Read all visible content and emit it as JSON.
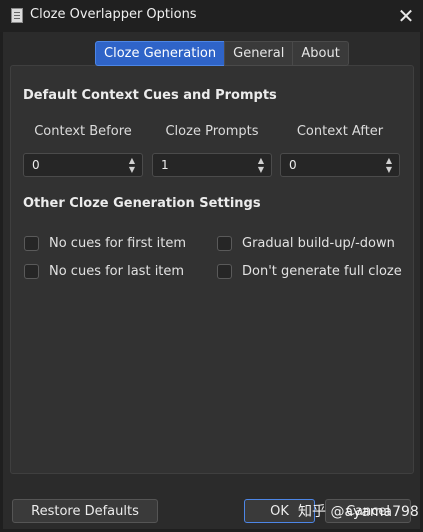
{
  "window": {
    "title": "Cloze Overlapper Options",
    "close_glyph": "✕"
  },
  "tabs": [
    {
      "label": "Cloze Generation",
      "active": true
    },
    {
      "label": "General",
      "active": false
    },
    {
      "label": "About",
      "active": false
    }
  ],
  "context_section": {
    "title": "Default Context Cues and Prompts",
    "fields": [
      {
        "label": "Context Before",
        "value": "0"
      },
      {
        "label": "Cloze Prompts",
        "value": "1"
      },
      {
        "label": "Context After",
        "value": "0"
      }
    ]
  },
  "other_section": {
    "title": "Other Cloze Generation Settings",
    "checkboxes": [
      {
        "label": "No cues for first item",
        "checked": false
      },
      {
        "label": "Gradual build-up/-down",
        "checked": false
      },
      {
        "label": "No cues for last item",
        "checked": false
      },
      {
        "label": "Don't generate full cloze",
        "checked": false
      }
    ]
  },
  "footer": {
    "restore_label": "Restore Defaults",
    "ok_label": "OK",
    "cancel_label": "Cancel"
  },
  "watermark": {
    "text": "知乎 @ayama798"
  },
  "colors": {
    "accent": "#2f64c8",
    "background": "#2b2b2b"
  }
}
